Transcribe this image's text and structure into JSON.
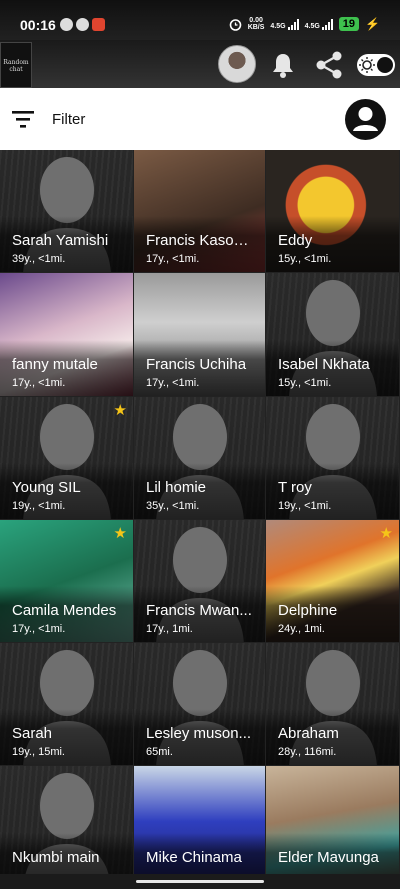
{
  "status_bar": {
    "time": "00:16",
    "net1_speed": "0.00",
    "net1_unit": "KB/S",
    "net2_label": "4.5G",
    "net3_label": "4.5G",
    "battery": "19",
    "notification_icons": [
      "chat-icon",
      "whatsapp-icon",
      "vivaldi-icon"
    ],
    "status_icons": [
      "alarm-icon",
      "signal-icon",
      "signal-icon",
      "charging-icon"
    ]
  },
  "toolbar": {
    "logo_text": "Random",
    "logo_subtext": "chat",
    "icons": [
      "bell-icon",
      "share-icon",
      "day-night-toggle-icon"
    ]
  },
  "filter_bar": {
    "label": "Filter"
  },
  "colors": {
    "star": "#f5c518",
    "battery": "#3ec14e",
    "filter_bar_bg": "#ffffff"
  },
  "profiles": [
    {
      "name": "Sarah Yamishi",
      "meta": "39y., <1mi.",
      "photo": false,
      "starred": false
    },
    {
      "name": "Francis Kason...",
      "meta": "17y., <1mi.",
      "photo": true,
      "starred": false
    },
    {
      "name": "Eddy",
      "meta": "15y., <1mi.",
      "photo": true,
      "starred": false
    },
    {
      "name": "fanny mutale",
      "meta": "17y., <1mi.",
      "photo": true,
      "starred": false
    },
    {
      "name": "Francis Uchiha",
      "meta": "17y., <1mi.",
      "photo": true,
      "starred": false
    },
    {
      "name": "Isabel Nkhata",
      "meta": "15y., <1mi.",
      "photo": false,
      "starred": false
    },
    {
      "name": "Young SIL",
      "meta": "19y., <1mi.",
      "photo": false,
      "starred": true
    },
    {
      "name": "Lil homie",
      "meta": "35y., <1mi.",
      "photo": false,
      "starred": false
    },
    {
      "name": "T roy",
      "meta": "19y., <1mi.",
      "photo": false,
      "starred": false
    },
    {
      "name": "Camila Mendes",
      "meta": "17y., <1mi.",
      "photo": true,
      "starred": true
    },
    {
      "name": "Francis Mwan...",
      "meta": "17y., 1mi.",
      "photo": false,
      "starred": false
    },
    {
      "name": "Delphine",
      "meta": "24y., 1mi.",
      "photo": true,
      "starred": true
    },
    {
      "name": "Sarah",
      "meta": "19y., 15mi.",
      "photo": false,
      "starred": false
    },
    {
      "name": "Lesley muson...",
      "meta": "65mi.",
      "photo": false,
      "starred": false
    },
    {
      "name": "Abraham",
      "meta": "28y., 116mi.",
      "photo": false,
      "starred": false
    },
    {
      "name": "Nkumbi main",
      "meta": "",
      "photo": false,
      "starred": false
    },
    {
      "name": "Mike Chinama",
      "meta": "",
      "photo": true,
      "starred": false
    },
    {
      "name": "Elder Mavunga",
      "meta": "",
      "photo": true,
      "starred": false
    }
  ]
}
